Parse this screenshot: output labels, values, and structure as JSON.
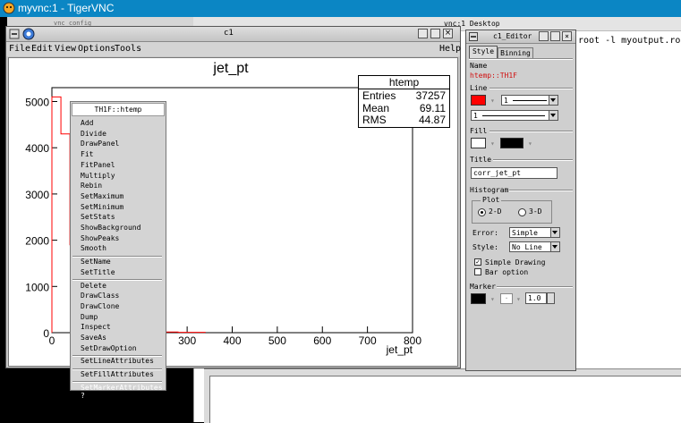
{
  "vnc": {
    "title": "myvnc:1 - TigerVNC"
  },
  "terminal": {
    "title_fragment": "vnc:1 Desktop",
    "command_fragment": "root -l myoutput.root",
    "left_tab_fragment": "vnc config"
  },
  "canvas_window": {
    "title": "c1",
    "menus": [
      "File",
      "Edit",
      "View",
      "Options",
      "Tools"
    ],
    "help": "Help"
  },
  "histogram": {
    "title": "jet_pt",
    "xlabel": "jet_pt",
    "stats": {
      "name": "htemp",
      "rows": [
        {
          "label": "Entries",
          "value": "37257"
        },
        {
          "label": "Mean",
          "value": "69.11"
        },
        {
          "label": "RMS",
          "value": "44.87"
        }
      ]
    }
  },
  "chart_data": {
    "type": "bar",
    "title": "jet_pt",
    "xlabel": "jet_pt",
    "ylabel": "",
    "xlim": [
      0,
      800
    ],
    "ylim": [
      0,
      5300
    ],
    "xticks": [
      "0",
      "100",
      "200",
      "300",
      "400",
      "500",
      "600",
      "700",
      "800"
    ],
    "yticks": [
      "0",
      "1000",
      "2000",
      "3000",
      "4000",
      "5000"
    ],
    "bins": [
      {
        "x": 20,
        "y": 5100
      },
      {
        "x": 40,
        "y": 4300
      },
      {
        "x": 60,
        "y": 1900
      },
      {
        "x": 80,
        "y": 1000
      },
      {
        "x": 100,
        "y": 600
      },
      {
        "x": 120,
        "y": 350
      },
      {
        "x": 140,
        "y": 200
      },
      {
        "x": 160,
        "y": 120
      },
      {
        "x": 200,
        "y": 60
      },
      {
        "x": 240,
        "y": 30
      },
      {
        "x": 280,
        "y": 15
      },
      {
        "x": 340,
        "y": 8
      }
    ],
    "line_color": "#ff0000"
  },
  "context_menu": {
    "header": "TH1F::htemp",
    "groups": [
      [
        "Add",
        "Divide",
        "DrawPanel",
        "Fit",
        "FitPanel",
        "Multiply",
        "Rebin",
        "SetMaximum",
        "SetMinimum",
        "SetStats",
        "ShowBackground",
        "ShowPeaks",
        "Smooth"
      ],
      [
        "SetName",
        "SetTitle"
      ],
      [
        "Delete",
        "DrawClass",
        "DrawClone",
        "Dump",
        "Inspect",
        "SaveAs",
        "SetDrawOption"
      ],
      [
        "SetLineAttributes"
      ],
      [
        "SetFillAttributes"
      ],
      [
        "SetMarkerAttributes ?"
      ]
    ],
    "highlighted": "SetMarkerAttributes ?"
  },
  "editor": {
    "title": "c1_Editor",
    "tabs": [
      "Style",
      "Binning"
    ],
    "name_label": "Name",
    "name_value": "htemp::TH1F",
    "line_label": "Line",
    "line_color": "#ff0000",
    "line_width": "1",
    "line_style_value": "1",
    "fill_label": "Fill",
    "fill_color": "#ffffff",
    "fill_pattern_color": "#000000",
    "title_label": "Title",
    "title_value": "corr_jet_pt",
    "histogram_label": "Histogram",
    "plot_label": "Plot",
    "plot_2d": "2-D",
    "plot_3d": "3-D",
    "error_label": "Error:",
    "error_value": "Simple",
    "style_label": "Style:",
    "style_value": "No Line",
    "simple_drawing": "Simple Drawing",
    "bar_option": "Bar option",
    "marker_label": "Marker",
    "marker_color": "#000000",
    "marker_size": "1.0"
  }
}
